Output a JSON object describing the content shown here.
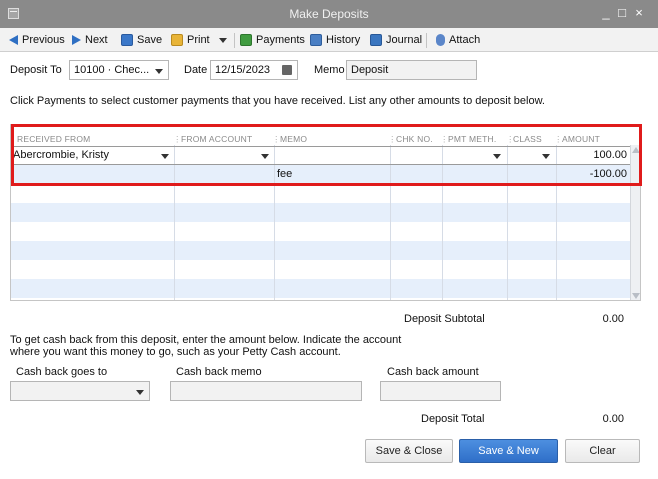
{
  "window": {
    "title": "Make Deposits",
    "minimize": "_",
    "maximize": "□",
    "close": "×"
  },
  "toolbar": {
    "previous": "Previous",
    "next": "Next",
    "save": "Save",
    "print": "Print",
    "payments": "Payments",
    "history": "History",
    "journal": "Journal",
    "attach": "Attach"
  },
  "header": {
    "deposit_to_label": "Deposit To",
    "deposit_to_value": "10100 · Chec...",
    "date_label": "Date",
    "date_value": "12/15/2023",
    "memo_label": "Memo",
    "memo_value": "Deposit"
  },
  "instructions": "Click Payments to select customer payments that you have received. List any other amounts to deposit below.",
  "grid": {
    "columns": [
      "RECEIVED FROM",
      "FROM ACCOUNT",
      "MEMO",
      "CHK NO.",
      "PMT METH.",
      "CLASS",
      "AMOUNT"
    ],
    "rows": [
      {
        "received_from": "Abercrombie, Kristy",
        "from_account": "",
        "memo": "",
        "chk_no": "",
        "pmt_meth": "",
        "class": "",
        "amount": "100.00"
      },
      {
        "received_from": "",
        "from_account": "",
        "memo": "fee",
        "chk_no": "",
        "pmt_meth": "",
        "class": "",
        "amount": "-100.00"
      }
    ]
  },
  "subtotal": {
    "label": "Deposit Subtotal",
    "value": "0.00"
  },
  "cashback": {
    "instructions_line1": "To get cash back from this deposit, enter the amount below.  Indicate the account",
    "instructions_line2": "where you want this money to go, such as your Petty Cash account.",
    "goes_to_label": "Cash back goes to",
    "memo_label": "Cash back memo",
    "amount_label": "Cash back amount"
  },
  "total": {
    "label": "Deposit Total",
    "value": "0.00"
  },
  "buttons": {
    "save_close": "Save & Close",
    "save_new": "Save & New",
    "clear": "Clear"
  },
  "colors": {
    "accent": "#2f6fc8",
    "highlight_border": "#e01b1b",
    "row_alt": "#e6effb",
    "titlebar": "#8a8a8a"
  }
}
